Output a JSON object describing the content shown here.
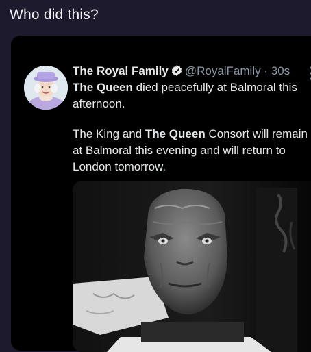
{
  "post_title": "Who did this?",
  "tweet": {
    "display_name": "The Royal Family",
    "handle": "@RoyalFamily",
    "separator": "·",
    "time": "30s",
    "icons": {
      "verified": "verified-badge-icon",
      "more": "more-options-icon"
    },
    "p1_bold": "The Queen",
    "p1_rest": " died peacefully at Balmoral this afternoon.",
    "p2_start": "The King and ",
    "p2_bold": "The Queen",
    "p2_rest": " Consort will remain at Balmoral this evening and will return to London tomorrow."
  },
  "colors": {
    "background": "#1c1a2c",
    "tweet_background": "#000000",
    "text": "#e7e9ea",
    "muted": "#8b98a5"
  }
}
